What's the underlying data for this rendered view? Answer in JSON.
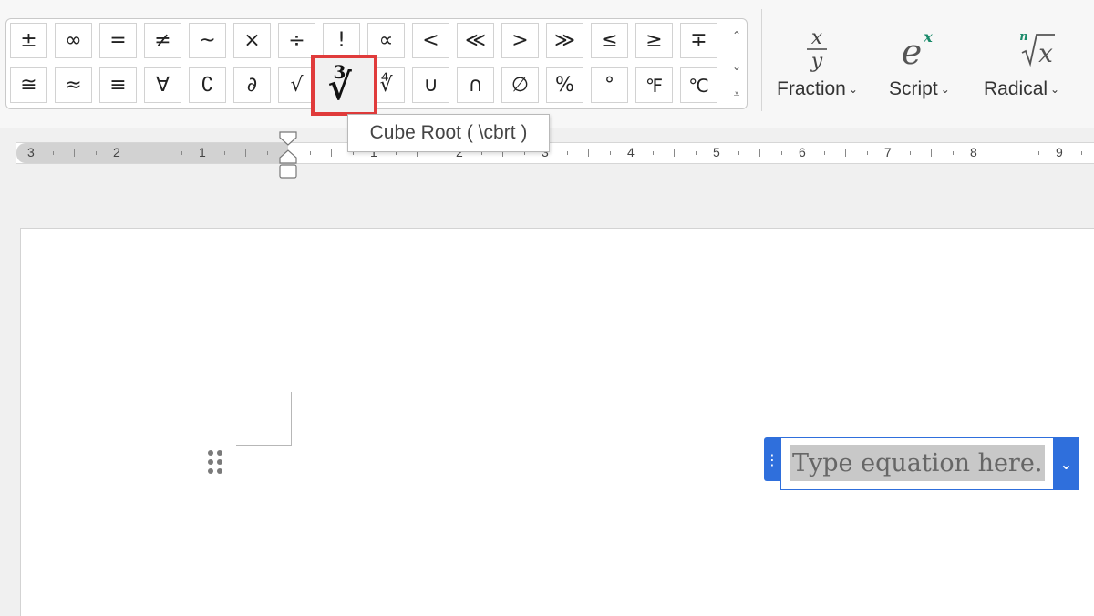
{
  "ribbon": {
    "symbols_row1": [
      "±",
      "∞",
      "=",
      "≠",
      "~",
      "×",
      "÷",
      "!",
      "∝",
      "<",
      "≪",
      ">",
      "≫",
      "≤",
      "≥",
      "∓"
    ],
    "symbols_row2": [
      "≅",
      "≈",
      "≡",
      "∀",
      "∁",
      "∂",
      "√",
      "∛",
      "∜",
      "∪",
      "∩",
      "∅",
      "%",
      "°",
      "℉",
      "℃"
    ],
    "cube_root_index": "3",
    "cube_root_radical": "√",
    "scroll_up": "⌃",
    "scroll_down": "⌄",
    "more": "⩡",
    "structures": [
      {
        "label": "Fraction",
        "chevron": "⌄"
      },
      {
        "label": "Script",
        "chevron": "⌄"
      },
      {
        "label": "Radical",
        "chevron": "⌄"
      }
    ],
    "fraction_icon": {
      "num": "x",
      "den": "y"
    },
    "script_icon": {
      "base": "e",
      "sup": "x"
    },
    "radical_icon": {
      "index": "n",
      "radicand": "x"
    }
  },
  "tooltip": {
    "text": "Cube Root ( \\cbrt )"
  },
  "ruler": {
    "left_numbers": [
      "3",
      "2",
      "1"
    ],
    "right_numbers": [
      "1",
      "2",
      "3",
      "4",
      "5",
      "6",
      "7",
      "8",
      "9"
    ]
  },
  "equation": {
    "placeholder": "Type equation here.",
    "handle_glyph": "⋮",
    "options_glyph": "⌄"
  },
  "colors": {
    "highlight": "#e03b3b",
    "equation_accent": "#2f6fdc",
    "icon_accent": "#1a8a6a"
  }
}
